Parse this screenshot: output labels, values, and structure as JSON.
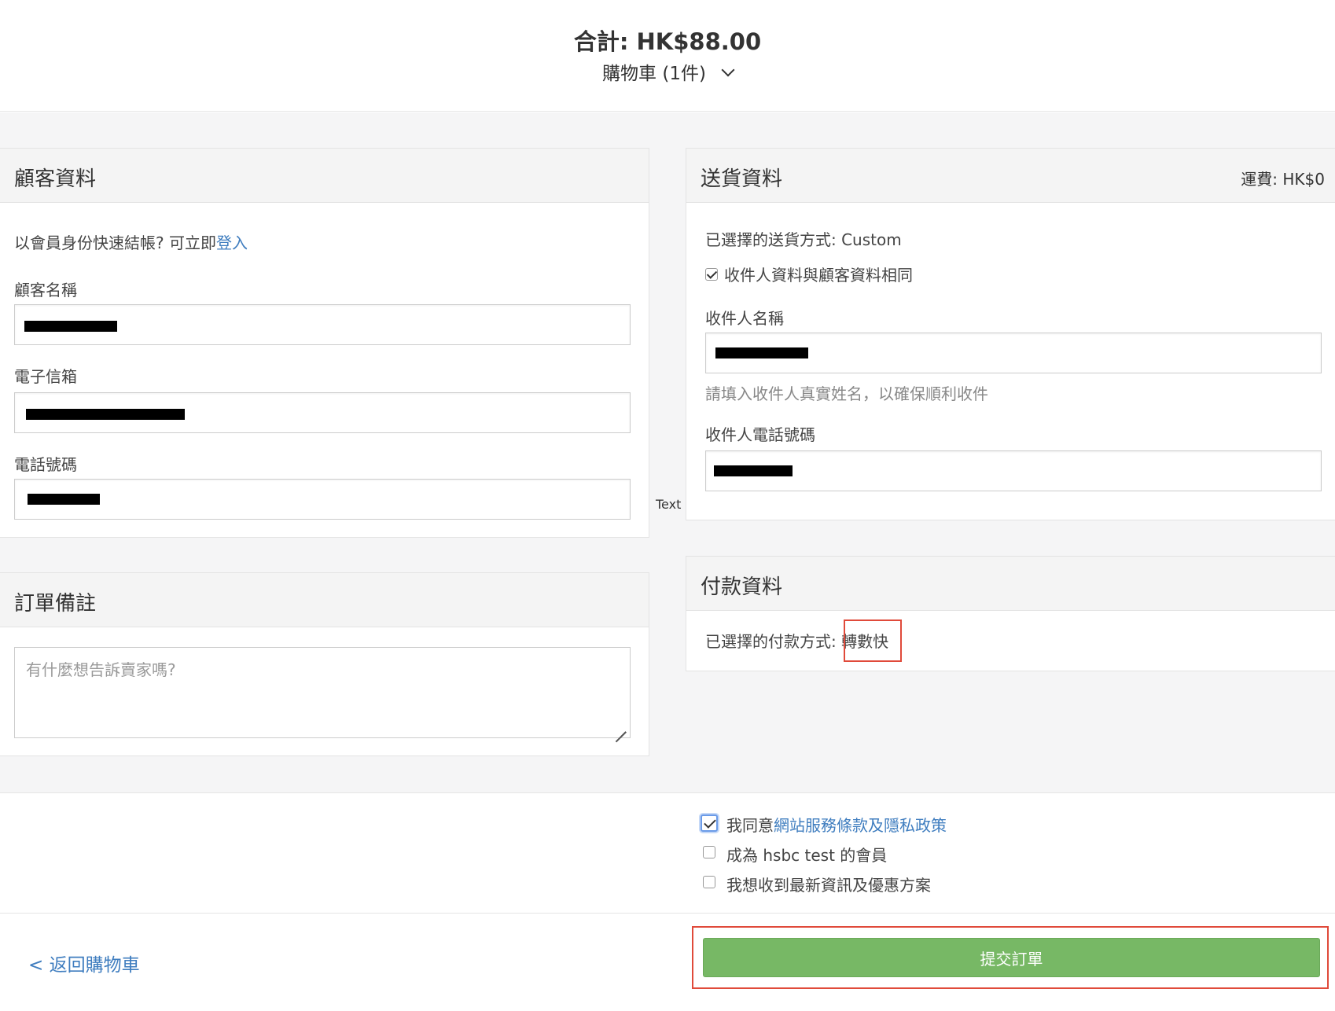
{
  "summary": {
    "total": "合計: HK$88.00",
    "cart_label": "購物車 (1件)"
  },
  "customer": {
    "title": "顧客資料",
    "login_prompt": "以會員身份快速結帳? 可立即",
    "login_link": "登入",
    "name_label": "顧客名稱",
    "email_label": "電子信箱",
    "phone_label": "電話號碼"
  },
  "delivery": {
    "title": "送貨資料",
    "fee": "運費: HK$0",
    "method": "已選擇的送貨方式: Custom",
    "same_as_customer": "收件人資料與顧客資料相同",
    "recipient_name_label": "收件人名稱",
    "recipient_name_hint": "請填入收件人真實姓名，以確保順利收件",
    "recipient_phone_label": "收件人電話號碼"
  },
  "annotation_text": "Text",
  "notes": {
    "title": "訂單備註",
    "placeholder": "有什麼想告訴賣家嗎?"
  },
  "payment": {
    "title": "付款資料",
    "method_label": "已選擇的付款方式: ",
    "method_value": "轉數快"
  },
  "agreements": {
    "agree_prefix": "我同意",
    "agree_link": "網站服務條款及隱私政策",
    "become_member": "成為 hsbc test 的會員",
    "newsletter": "我想收到最新資訊及優惠方案"
  },
  "footer": {
    "back_link": "< 返回購物車",
    "submit": "提交訂單"
  },
  "colors": {
    "link": "#3f7dbf",
    "submit": "#77b865",
    "annotation": "#e04a3a"
  }
}
